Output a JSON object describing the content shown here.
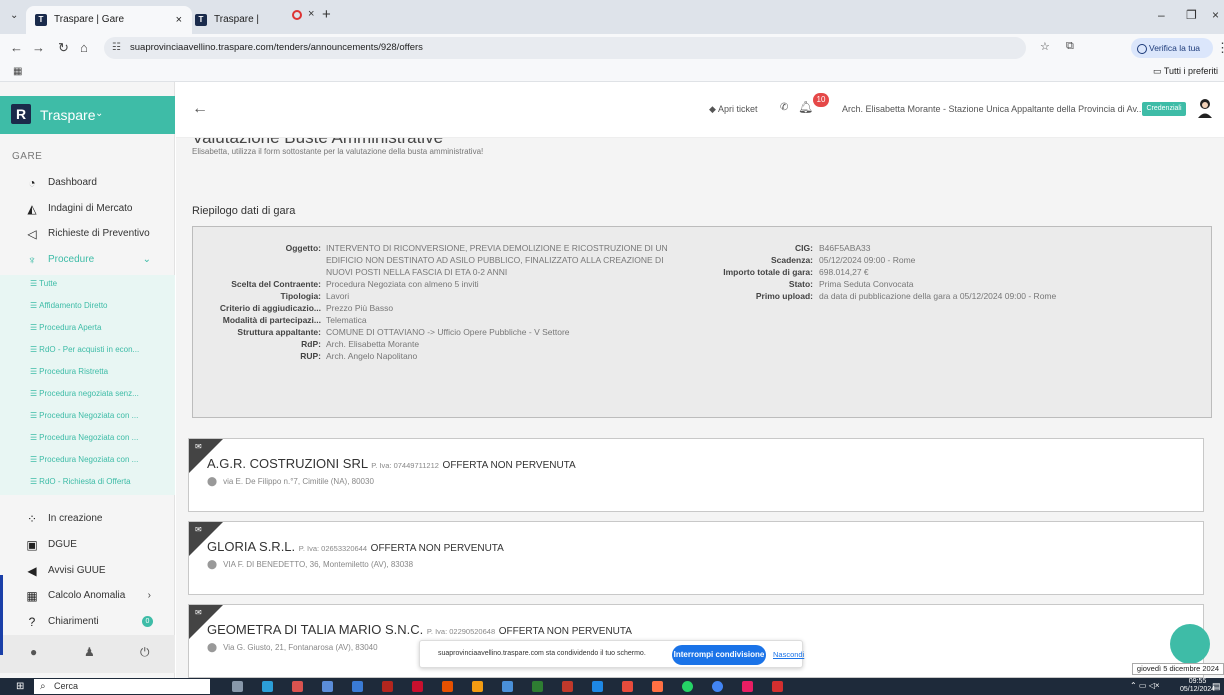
{
  "browser": {
    "tabs": [
      {
        "title": "Traspare | Gare",
        "active": true
      },
      {
        "title": "Traspare | Gare",
        "active": false
      }
    ],
    "url": "suaprovinciaavellino.traspare.com/tenders/announcements/928/offers",
    "verify_label": "Verifica la tua identità",
    "favorites_label": "Tutti i preferiti"
  },
  "sidebar": {
    "brand": "Traspare",
    "section_label": "GARE",
    "items": [
      {
        "label": "Dashboard",
        "icon": "gauge-icon"
      },
      {
        "label": "Indagini di Mercato",
        "icon": "chart-area-icon"
      },
      {
        "label": "Richieste di Preventivo",
        "icon": "paper-plane-icon"
      },
      {
        "label": "Procedure",
        "icon": "trophy-icon"
      }
    ],
    "procedure_submenu": [
      "Tutte",
      "Affidamento Diretto",
      "Procedura Aperta",
      "RdO - Per acquisti in econ...",
      "Procedura Ristretta",
      "Procedura negoziata senz...",
      "Procedura Negoziata con ...",
      "Procedura Negoziata con ...",
      "Procedura Negoziata con ...",
      "RdO - Richiesta di Offerta"
    ],
    "items_after": [
      {
        "label": "In creazione",
        "icon": "spinner-icon"
      },
      {
        "label": "DGUE",
        "icon": "document-icon"
      },
      {
        "label": "Avvisi GUUE",
        "icon": "megaphone-icon"
      },
      {
        "label": "Calcolo Anomalia",
        "icon": "calculator-icon"
      },
      {
        "label": "Chiarimenti",
        "icon": "question-icon",
        "badge": "0"
      }
    ]
  },
  "header": {
    "ticket_label": "Apri ticket",
    "notifications_count": "10",
    "user": "Arch. Elisabetta Morante - Stazione Unica Appaltante della Provincia di Av...",
    "credentials_label": "Credenziali"
  },
  "page": {
    "title": "Valutazione Buste Amministrative",
    "subtitle": "Elisabetta, utilizza il form sottostante per la valutazione della busta amministrativa!",
    "summary_title": "Riepilogo dati di gara",
    "summary_left": [
      {
        "label": "Oggetto:",
        "value": [
          "INTERVENTO DI RICONVERSIONE, PREVIA DEMOLIZIONE E RICOSTRUZIONE DI UN",
          "EDIFICIO NON DESTINATO AD ASILO PUBBLICO, FINALIZZATO ALLA CREAZIONE DI",
          "NUOVI POSTI NELLA FASCIA DI ETA 0-2 ANNI"
        ]
      },
      {
        "label": "Scelta del Contraente:",
        "value": [
          "Procedura Negoziata con almeno 5 inviti"
        ]
      },
      {
        "label": "Tipologia:",
        "value": [
          "Lavori"
        ]
      },
      {
        "label": "Criterio di aggiudicazio...",
        "value": [
          "Prezzo Più Basso"
        ]
      },
      {
        "label": "Modalità di partecipazi...",
        "value": [
          "Telematica"
        ]
      },
      {
        "label": "Struttura appaltante:",
        "value": [
          "COMUNE DI OTTAVIANO -> Ufficio Opere Pubbliche - V Settore"
        ]
      },
      {
        "label": "RdP:",
        "value": [
          "Arch. Elisabetta Morante"
        ]
      },
      {
        "label": "RUP:",
        "value": [
          "Arch. Angelo Napolitano"
        ]
      }
    ],
    "summary_right": [
      {
        "label": "CIG:",
        "value": "B46F5ABA33"
      },
      {
        "label": "Scadenza:",
        "value": "05/12/2024 09:00 - Rome"
      },
      {
        "label": "Importo totale di gara:",
        "value": "698.014,27 €"
      },
      {
        "label": "Stato:",
        "value": "Prima Seduta Convocata"
      },
      {
        "label": "Primo upload:",
        "value": "da data di pubblicazione della gara a 05/12/2024 09:00 - Rome"
      }
    ],
    "offers": [
      {
        "company": "A.G.R. COSTRUZIONI SRL",
        "piva": "P. Iva: 07449711212",
        "status": "OFFERTA NON PERVENUTA",
        "address": "via E. De Filippo n.°7, Cimitile (NA), 80030"
      },
      {
        "company": "GLORIA S.R.L.",
        "piva": "P. Iva: 02653320644",
        "status": "OFFERTA NON PERVENUTA",
        "address": "VIA F. DI BENEDETTO, 36, Montemiletto (AV), 83038"
      },
      {
        "company": "GEOMETRA DI TALIA MARIO S.N.C.",
        "piva": "P. Iva: 02290520648",
        "status": "OFFERTA NON PERVENUTA",
        "address": "Via G. Giusto, 21, Fontanarosa (AV), 83040"
      }
    ]
  },
  "share_bar": {
    "text": "suaprovinciaavellino.traspare.com sta condividendo il tuo schermo.",
    "stop_label": "Interrompi condivisione",
    "hide_label": "Nascondi"
  },
  "taskbar": {
    "search_placeholder": "Cerca",
    "time": "09:55",
    "date": "05/12/2024",
    "date_tooltip": "giovedì 5 dicembre 2024"
  }
}
